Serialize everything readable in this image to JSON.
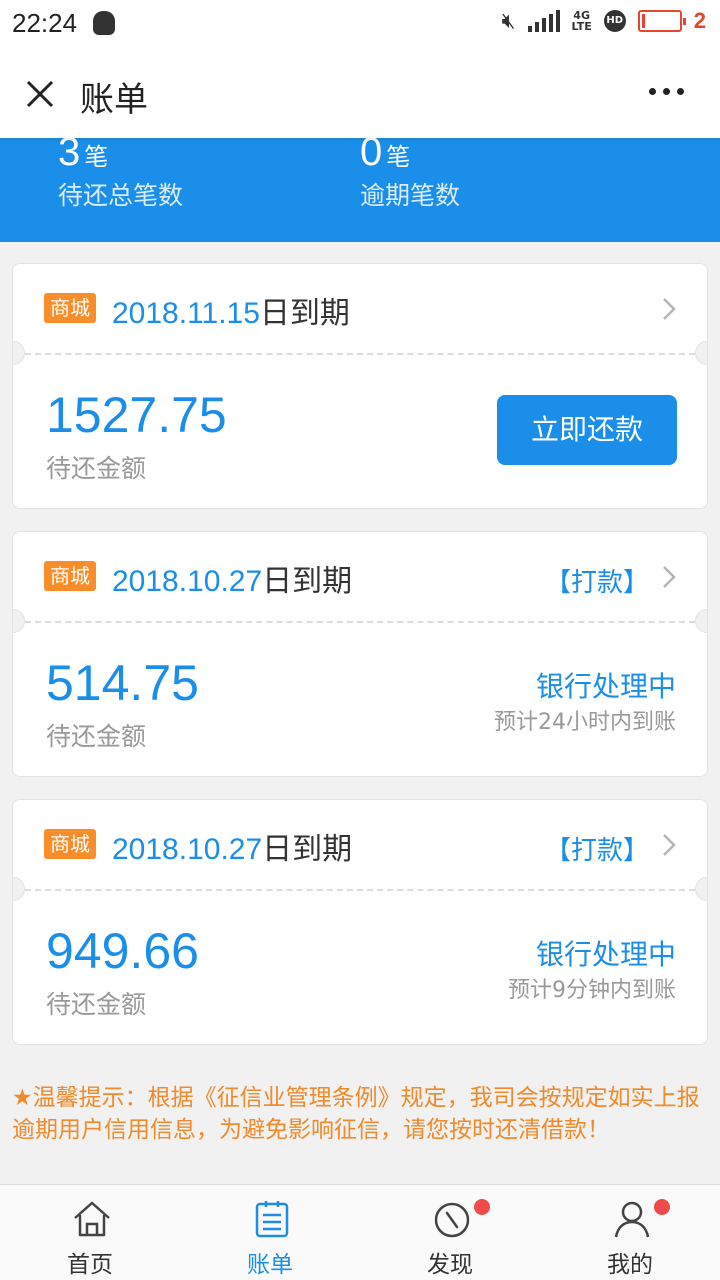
{
  "status_bar": {
    "time": "22:24",
    "network": "4G",
    "network_sub": "LTE",
    "hd": "HD",
    "battery_level": "2"
  },
  "nav": {
    "title": "账单"
  },
  "summary": {
    "pending_count": "3",
    "pending_unit": "笔",
    "pending_label": "待还总笔数",
    "overdue_count": "0",
    "overdue_unit": "笔",
    "overdue_label": "逾期笔数"
  },
  "bills": [
    {
      "tag": "商城",
      "date": "2018.11.15",
      "due_suffix": "日到期",
      "amount": "1527.75",
      "amount_label": "待还金额",
      "action_label": "立即还款"
    },
    {
      "tag": "商城",
      "date": "2018.10.27",
      "due_suffix": "日到期",
      "payment_link": "【打款】",
      "amount": "514.75",
      "amount_label": "待还金额",
      "status": "银行处理中",
      "status_note": "预计24小时内到账"
    },
    {
      "tag": "商城",
      "date": "2018.10.27",
      "due_suffix": "日到期",
      "payment_link": "【打款】",
      "amount": "949.66",
      "amount_label": "待还金额",
      "status": "银行处理中",
      "status_note": "预计9分钟内到账"
    }
  ],
  "notice": "★温馨提示：根据《征信业管理条例》规定，我司会按规定如实上报逾期用户信用信息，为避免影响征信，请您按时还清借款！",
  "tabbar": [
    {
      "label": "首页",
      "icon": "home-icon"
    },
    {
      "label": "账单",
      "icon": "bill-icon"
    },
    {
      "label": "发现",
      "icon": "compass-icon"
    },
    {
      "label": "我的",
      "icon": "user-icon"
    }
  ],
  "colors": {
    "primary_blue": "#1a8ee8",
    "tag_orange": "#f88d2a",
    "notice_orange": "#f08a2a",
    "badge_red": "#ef4b4b"
  }
}
